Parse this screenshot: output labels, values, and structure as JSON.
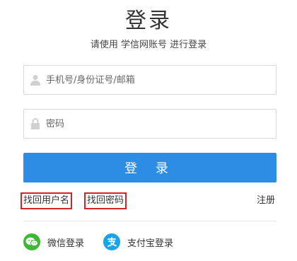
{
  "title": "登录",
  "subtitle": "请使用 学信网账号 进行登录",
  "form": {
    "username_placeholder": "手机号/身份证号/邮箱",
    "password_placeholder": "密码",
    "login_label": "登 录"
  },
  "links": {
    "find_username": "找回用户名",
    "find_password": "找回密码",
    "register": "注册"
  },
  "social": [
    {
      "label": "微信登录",
      "icon": "wechat-icon",
      "color": "#3fb837"
    },
    {
      "label": "支付宝登录",
      "icon": "alipay-icon",
      "color": "#1aa3e8"
    }
  ],
  "colors": {
    "primary": "#2d8ce3",
    "highlight_border": "#d62424"
  }
}
